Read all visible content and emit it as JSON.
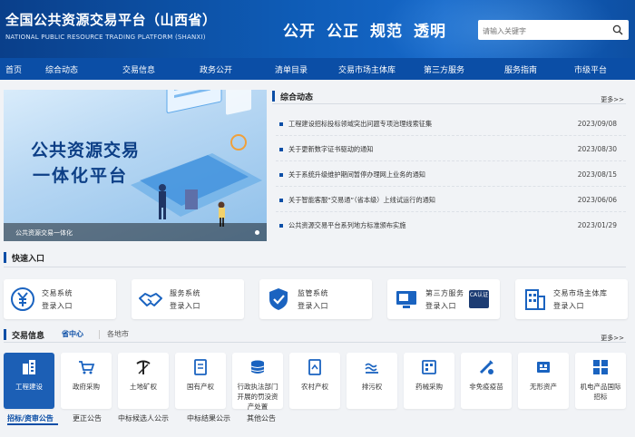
{
  "header": {
    "title": "全国公共资源交易平台（山西省）",
    "subtitle": "NATIONAL PUBLIC RESOURCE TRADING PLATFORM (SHANXI)",
    "slogans": [
      "公开",
      "公正",
      "规范",
      "透明"
    ],
    "search_placeholder": "请输入关键字"
  },
  "nav": [
    "首页",
    "综合动态",
    "交易信息",
    "政务公开",
    "清单目录",
    "交易市场主体库",
    "第三方服务",
    "服务指南",
    "市级平台"
  ],
  "banner": {
    "title_line1": "公共资源交易",
    "title_line2": "一体化平台",
    "caption": "公共资源交易一体化"
  },
  "news": {
    "title": "综合动态",
    "more": "更多>>",
    "items": [
      {
        "text": "工程建设招标投标领域突出问题专项治理线索征集",
        "date": "2023/09/08"
      },
      {
        "text": "关于更新数字证书驱动的通知",
        "date": "2023/08/30"
      },
      {
        "text": "关于系统升级维护期间暂停办理网上业务的通知",
        "date": "2023/08/15"
      },
      {
        "text": "关于智能客服“交易通”（省本级）上线试运行的通知",
        "date": "2023/06/06"
      },
      {
        "text": "公共资源交易平台系列地方标准颁布实施",
        "date": "2023/01/29"
      }
    ]
  },
  "quick": {
    "title": "快速入口",
    "cards": [
      {
        "line1": "交易系统",
        "line2": "登录入口",
        "icon": "yuan-icon"
      },
      {
        "line1": "服务系统",
        "line2": "登录入口",
        "icon": "handshake-icon"
      },
      {
        "line1": "监管系统",
        "line2": "登录入口",
        "icon": "shield-check-icon"
      },
      {
        "line1": "第三方服务",
        "line2": "登录入口",
        "icon": "monitor-icon",
        "badge": "CA认证"
      },
      {
        "line1": "交易市场主体库",
        "line2": "登录入口",
        "icon": "building-icon"
      }
    ]
  },
  "trade": {
    "title": "交易信息",
    "tab_province": "省中心",
    "tab_cities": "各地市",
    "more": "更多>>",
    "categories": [
      {
        "label": "工程建设",
        "icon": "building-icon",
        "active": true
      },
      {
        "label": "政府采购",
        "icon": "cart-icon"
      },
      {
        "label": "土地矿权",
        "icon": "pickaxe-icon"
      },
      {
        "label": "国有产权",
        "icon": "document-icon"
      },
      {
        "label": "行政执法部门开展的罚没资产处置",
        "icon": "coins-icon"
      },
      {
        "label": "农村产权",
        "icon": "farm-doc-icon"
      },
      {
        "label": "排污权",
        "icon": "emission-icon"
      },
      {
        "label": "药械采购",
        "icon": "medicine-icon"
      },
      {
        "label": "非免疫疫苗",
        "icon": "vaccine-icon"
      },
      {
        "label": "无形资产",
        "icon": "asset-icon"
      },
      {
        "label": "机电产品国际招标",
        "icon": "grid-icon"
      }
    ],
    "bottom_tabs": [
      "招标/资审公告",
      "更正公告",
      "中标候选人公示",
      "中标结果公示",
      "其他公告"
    ]
  },
  "colors": {
    "primary": "#0b4ea6",
    "header_dark": "#0a3f8a",
    "background": "#f1f3f6",
    "active_tile": "#1c5fb5"
  }
}
